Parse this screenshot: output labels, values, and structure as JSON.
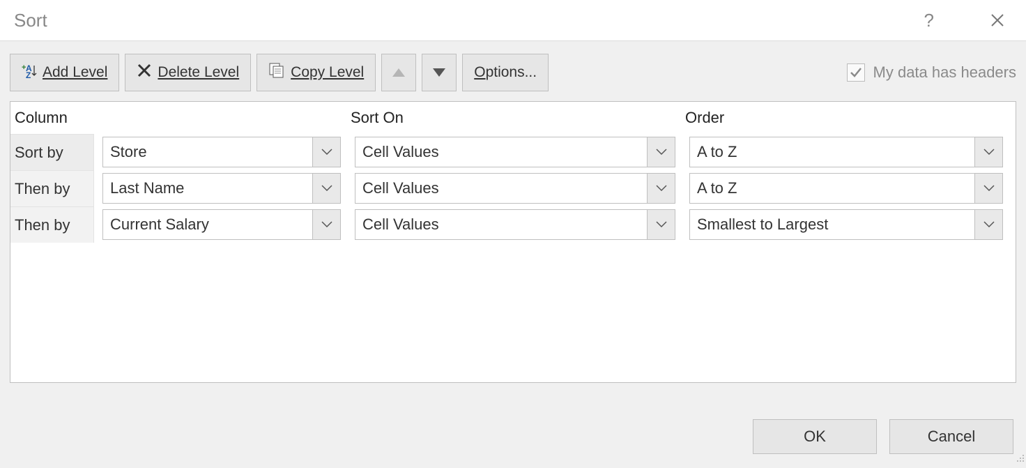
{
  "title": "Sort",
  "toolbar": {
    "add_level": "Add Level",
    "delete_level": "Delete Level",
    "copy_level": "Copy Level",
    "options": "Options...",
    "headers_label_pre": "My data has ",
    "headers_label_u": "h",
    "headers_label_post": "eaders",
    "headers_checked": true
  },
  "headers": {
    "column": "Column",
    "sort_on": "Sort On",
    "order": "Order"
  },
  "rows": [
    {
      "label": "Sort by",
      "column": "Store",
      "sort_on": "Cell Values",
      "order": "A to Z"
    },
    {
      "label": "Then by",
      "column": "Last Name",
      "sort_on": "Cell Values",
      "order": "A to Z"
    },
    {
      "label": "Then by",
      "column": "Current Salary",
      "sort_on": "Cell Values",
      "order": "Smallest to Largest"
    }
  ],
  "footer": {
    "ok": "OK",
    "cancel": "Cancel"
  }
}
